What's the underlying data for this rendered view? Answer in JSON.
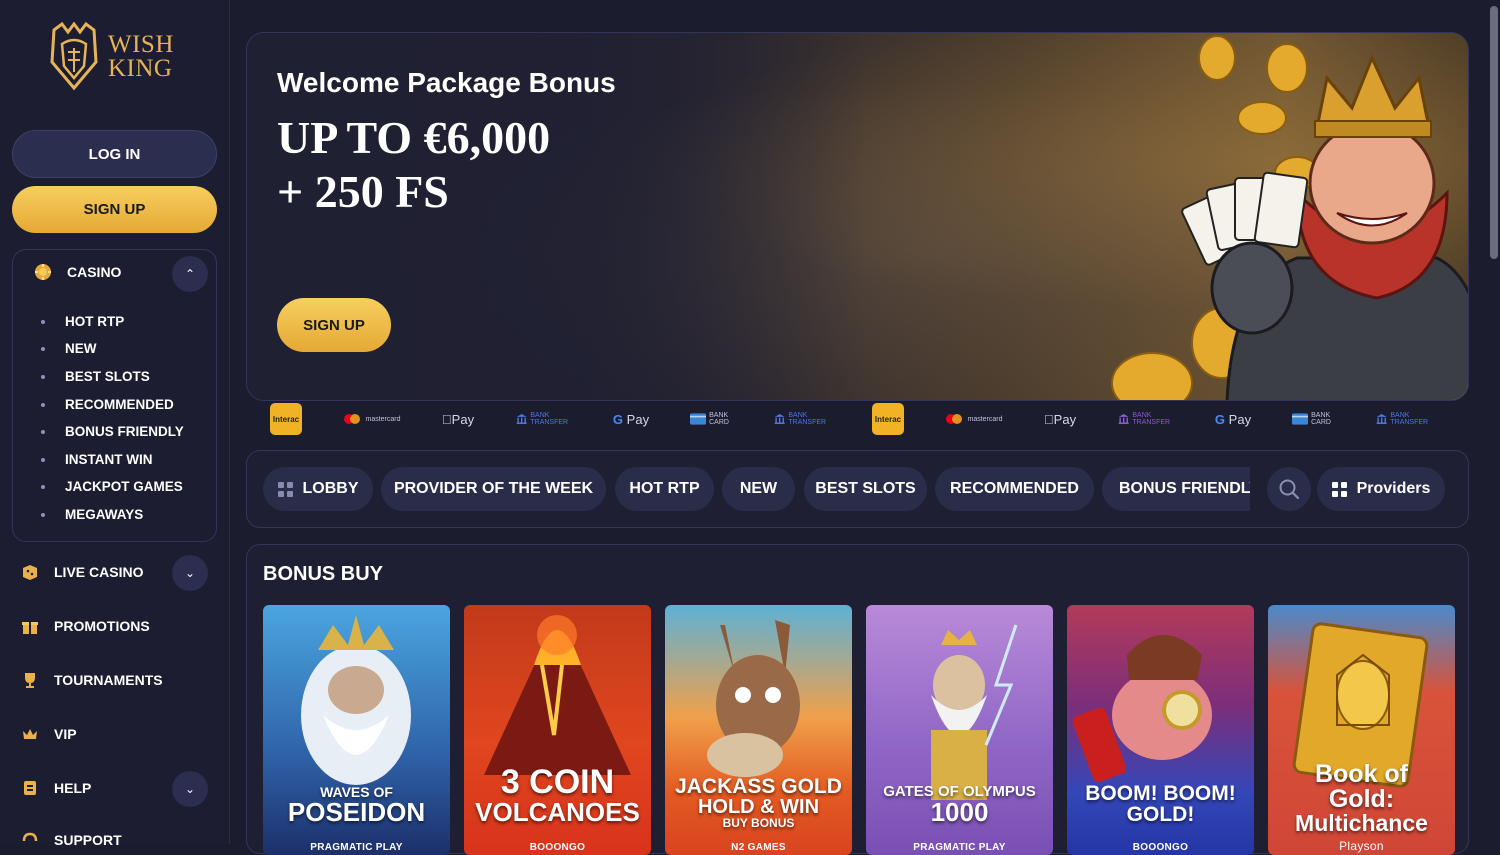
{
  "brand": {
    "logo_line1": "WISH",
    "logo_line2": "KING",
    "gold": "#e6b357"
  },
  "sidebar": {
    "login_label": "LOG IN",
    "signup_label": "SIGN UP",
    "casino": {
      "label": "CASINO",
      "icon": "casino-chip-icon",
      "expanded": true,
      "items": [
        "HOT RTP",
        "NEW",
        "BEST SLOTS",
        "RECOMMENDED",
        "BONUS FRIENDLY",
        "INSTANT WIN",
        "JACKPOT GAMES",
        "MEGAWAYS"
      ]
    },
    "nav": [
      {
        "label": "LIVE CASINO",
        "icon": "live-casino-icon",
        "has_chevron": true
      },
      {
        "label": "PROMOTIONS",
        "icon": "gift-icon",
        "has_chevron": false
      },
      {
        "label": "TOURNAMENTS",
        "icon": "trophy-icon",
        "has_chevron": false
      },
      {
        "label": "VIP",
        "icon": "crown-icon",
        "has_chevron": false
      },
      {
        "label": "HELP",
        "icon": "help-icon",
        "has_chevron": true
      },
      {
        "label": "SUPPORT",
        "icon": "support-icon",
        "has_chevron": false
      }
    ]
  },
  "hero": {
    "subtitle": "Welcome Package Bonus",
    "title_line1": "UP TO €6,000",
    "title_line2": "+ 250 FS",
    "button_label": "SIGN UP"
  },
  "payments": [
    {
      "name": "Interac",
      "icon": "interac-icon"
    },
    {
      "name": "mastercard",
      "icon": "mastercard-icon"
    },
    {
      "name": "Pay",
      "icon": "apple-pay-icon"
    },
    {
      "name": "BANK TRANSFER",
      "icon": "bank-icon"
    },
    {
      "name": "Pay",
      "icon": "google-pay-icon"
    },
    {
      "name": "BANK CARD",
      "icon": "bank-card-icon"
    },
    {
      "name": "BANK TRANSFER",
      "icon": "bank-icon"
    },
    {
      "name": "Interac",
      "icon": "interac-icon"
    },
    {
      "name": "mastercard",
      "icon": "mastercard-icon"
    },
    {
      "name": "Pay",
      "icon": "apple-pay-icon"
    },
    {
      "name": "BANK TRANSFER",
      "icon": "bank-icon"
    },
    {
      "name": "Pay",
      "icon": "google-pay-icon"
    },
    {
      "name": "BANK CARD",
      "icon": "bank-card-icon"
    },
    {
      "name": "BANK TRANSFER",
      "icon": "bank-icon"
    }
  ],
  "tabs": [
    "LOBBY",
    "PROVIDER OF THE WEEK",
    "HOT RTP",
    "NEW",
    "BEST SLOTS",
    "RECOMMENDED",
    "BONUS FRIENDLY"
  ],
  "providers_label": "Providers",
  "games_section": {
    "title": "BONUS BUY",
    "games": [
      {
        "name_top": "WAVES OF",
        "name_main": "POSEIDON",
        "provider": "PRAGMATIC PLAY",
        "bg": "#3a7fc4"
      },
      {
        "name_top": "3 COIN",
        "name_main": "VOLCANOES",
        "provider": "BOOONGO",
        "bg": "#d2391e"
      },
      {
        "name_top": "JACKASS GOLD",
        "name_main": "HOLD & WIN",
        "name_sub": "BUY BONUS",
        "provider": "N2 GAMES",
        "bg": "#e2512a"
      },
      {
        "name_top": "GATES OF OLYMPUS",
        "name_main": "1000",
        "provider": "PRAGMATIC PLAY",
        "bg": "#8a6bc8"
      },
      {
        "name_top": "BOOM! BOOM!",
        "name_main": "GOLD!",
        "provider": "BOOONGO",
        "bg": "#3347b8"
      },
      {
        "name_top": "Book of",
        "name_main": "Gold:",
        "name_sub": "Multichance",
        "provider": "Playson",
        "bg": "#d04636"
      }
    ]
  }
}
